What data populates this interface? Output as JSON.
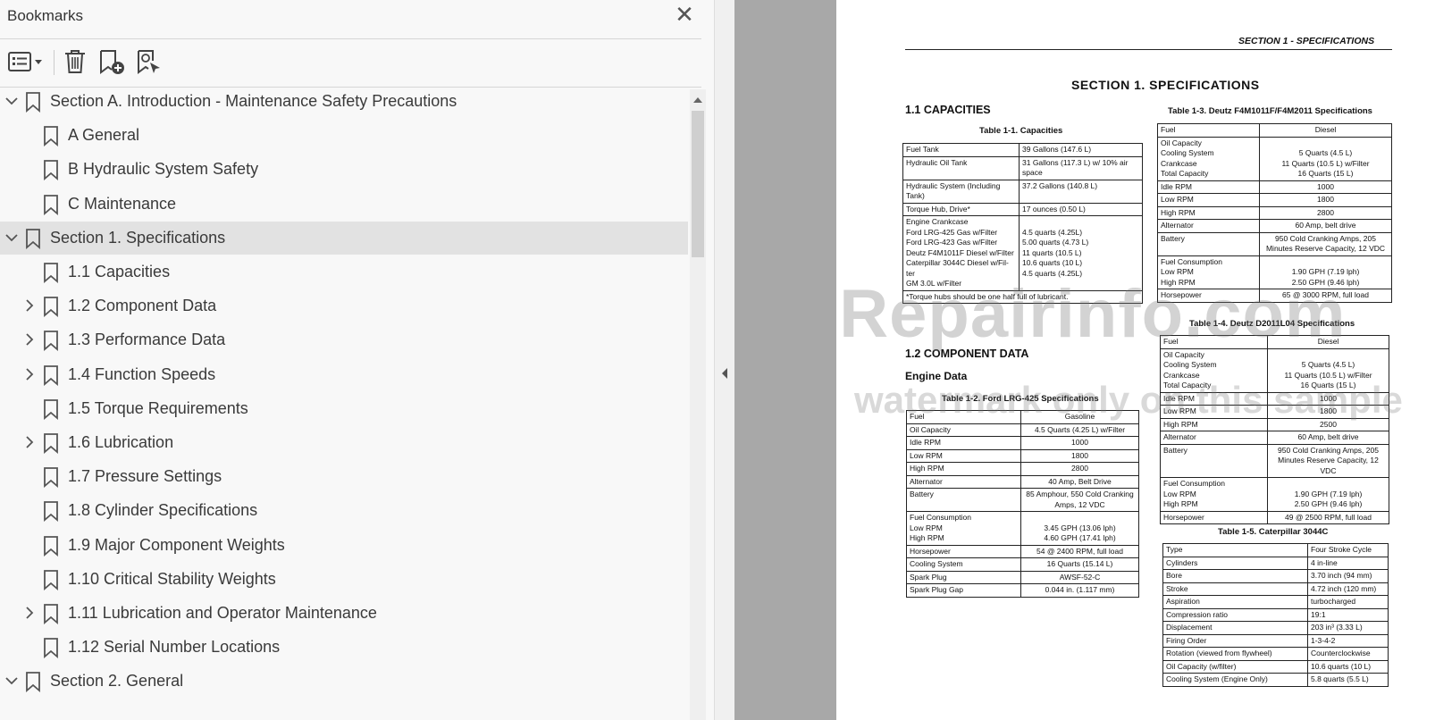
{
  "panel": {
    "title": "Bookmarks",
    "close_glyph": "✕",
    "toolbar": {
      "options_icon": "bookmark-options-icon",
      "delete_icon": "trash-icon",
      "new_bookmark_icon": "new-bookmark-icon",
      "find_bookmark_icon": "find-current-bookmark-icon"
    }
  },
  "bookmarks": [
    {
      "label": "Section A. Introduction - Maintenance Safety Precautions",
      "level": 0,
      "toggle": "expanded"
    },
    {
      "label": "A General",
      "level": 1,
      "toggle": "none"
    },
    {
      "label": "B Hydraulic System Safety",
      "level": 1,
      "toggle": "none"
    },
    {
      "label": "C Maintenance",
      "level": 1,
      "toggle": "none"
    },
    {
      "label": "Section 1. Specifications",
      "level": 0,
      "toggle": "expanded",
      "selected": true
    },
    {
      "label": "1.1 Capacities",
      "level": 1,
      "toggle": "none"
    },
    {
      "label": "1.2 Component Data",
      "level": 1,
      "toggle": "collapsed"
    },
    {
      "label": "1.3 Performance Data",
      "level": 1,
      "toggle": "collapsed"
    },
    {
      "label": "1.4 Function Speeds",
      "level": 1,
      "toggle": "collapsed"
    },
    {
      "label": "1.5 Torque Requirements",
      "level": 1,
      "toggle": "none"
    },
    {
      "label": "1.6 Lubrication",
      "level": 1,
      "toggle": "collapsed"
    },
    {
      "label": "1.7 Pressure Settings",
      "level": 1,
      "toggle": "none"
    },
    {
      "label": "1.8 Cylinder Specifications",
      "level": 1,
      "toggle": "none"
    },
    {
      "label": "1.9 Major Component Weights",
      "level": 1,
      "toggle": "none"
    },
    {
      "label": "1.10 Critical Stability Weights",
      "level": 1,
      "toggle": "none"
    },
    {
      "label": "1.11 Lubrication and Operator Maintenance",
      "level": 1,
      "toggle": "collapsed"
    },
    {
      "label": "1.12 Serial Number Locations",
      "level": 1,
      "toggle": "none"
    },
    {
      "label": "Section 2. General",
      "level": 0,
      "toggle": "expanded"
    }
  ],
  "document": {
    "running_header": "SECTION 1 - SPECIFICATIONS",
    "section_title": "SECTION 1.  SPECIFICATIONS",
    "h_capacities": "1.1   CAPACITIES",
    "h_component": "1.2   COMPONENT DATA",
    "h_engine": "Engine Data",
    "watermark_1": "eRepairinfo.com",
    "watermark_2": "watermark only on this sample",
    "t11": {
      "caption": "Table 1-1. Capacities",
      "rows": [
        [
          "Fuel Tank",
          "39 Gallons (147.6 L)"
        ],
        [
          "Hydraulic Oil Tank",
          "31 Gallons (117.3 L) w/ 10% air space"
        ],
        [
          "Hydraulic System (Including\nTank)",
          "37.2 Gallons (140.8 L)"
        ],
        [
          "Torque Hub, Drive*",
          "17 ounces (0.50 L)"
        ],
        [
          "Engine Crankcase\n   Ford LRG-425 Gas w/Filter\n   Ford LRG-423 Gas w/Filter\n   Deutz F4M1011F Diesel w/Filter\n   Caterpillar 3044C Diesel w/Fil-\nter\n   GM 3.0L w/Filter",
          "\n4.5 quarts (4.25L)\n5.00 quarts (4.73 L)\n11 quarts (10.5 L)\n10.6 quarts (10 L)\n4.5 quarts (4.25L)"
        ],
        [
          "*Torque hubs should be one half full of lubricant.",
          ""
        ]
      ]
    },
    "t12": {
      "caption": "Table 1-2. Ford LRG-425 Specifications",
      "rows": [
        [
          "Fuel",
          "Gasoline"
        ],
        [
          "Oil Capacity",
          "4.5 Quarts (4.25 L) w/Filter"
        ],
        [
          "Idle RPM",
          "1000"
        ],
        [
          "Low RPM",
          "1800"
        ],
        [
          "High RPM",
          "2800"
        ],
        [
          "Alternator",
          "40 Amp, Belt Drive"
        ],
        [
          "Battery",
          "85 Amphour, 550 Cold Cranking\nAmps, 12 VDC"
        ],
        [
          "Fuel Consumption\n   Low RPM\n   High RPM",
          "\n3.45 GPH (13.06 lph)\n4.60 GPH (17.41 lph)"
        ],
        [
          "Horsepower",
          "54 @ 2400 RPM, full load"
        ],
        [
          "Cooling System",
          "16 Quarts (15.14 L)"
        ],
        [
          "Spark Plug",
          "AWSF-52-C"
        ],
        [
          "Spark Plug Gap",
          "0.044 in. (1.117 mm)"
        ]
      ]
    },
    "t13": {
      "caption": "Table 1-3. Deutz F4M1011F/F4M2011 Specifications",
      "rows": [
        [
          "Fuel",
          "Diesel"
        ],
        [
          "Oil Capacity\n   Cooling System\n   Crankcase\n   Total Capacity",
          "\n5 Quarts (4.5 L)\n11 Quarts (10.5 L) w/Filter\n16 Quarts (15 L)"
        ],
        [
          "Idle RPM",
          "1000"
        ],
        [
          "Low RPM",
          "1800"
        ],
        [
          "High RPM",
          "2800"
        ],
        [
          "Alternator",
          "60 Amp, belt drive"
        ],
        [
          "Battery",
          "950 Cold Cranking Amps, 205\nMinutes Reserve Capacity, 12 VDC"
        ],
        [
          "Fuel Consumption\n   Low RPM\n   High RPM",
          "\n1.90 GPH (7.19 lph)\n2.50 GPH (9.46 lph)"
        ],
        [
          "Horsepower",
          "65 @ 3000 RPM, full load"
        ]
      ]
    },
    "t14": {
      "caption": "Table 1-4. Deutz D2011L04 Specifications",
      "rows": [
        [
          "Fuel",
          "Diesel"
        ],
        [
          "Oil Capacity\n   Cooling System\n   Crankcase\n   Total Capacity",
          "\n5 Quarts (4.5 L)\n11 Quarts (10.5 L) w/Filter\n16 Quarts (15 L)"
        ],
        [
          "Idle RPM",
          "1000"
        ],
        [
          "Low RPM",
          "1800"
        ],
        [
          "High RPM",
          "2500"
        ],
        [
          "Alternator",
          "60 Amp, belt drive"
        ],
        [
          "Battery",
          "950 Cold Cranking Amps, 205\nMinutes Reserve Capacity, 12 VDC"
        ],
        [
          "Fuel Consumption\n   Low RPM\n   High RPM",
          "\n1.90 GPH (7.19 lph)\n2.50 GPH (9.46 lph)"
        ],
        [
          "Horsepower",
          "49 @ 2500 RPM, full load"
        ]
      ]
    },
    "t15": {
      "caption": "Table 1-5. Caterpillar 3044C",
      "rows": [
        [
          "Type",
          "Four Stroke Cycle"
        ],
        [
          "Cylinders",
          "4 in-line"
        ],
        [
          "Bore",
          "3.70 inch (94 mm)"
        ],
        [
          "Stroke",
          "4.72 inch (120 mm)"
        ],
        [
          "Aspiration",
          "turbocharged"
        ],
        [
          "Compression ratio",
          "19:1"
        ],
        [
          "Displacement",
          "203 in³ (3.33 L)"
        ],
        [
          "Firing Order",
          "1-3-4-2"
        ],
        [
          "Rotation (viewed from flywheel)",
          "Counterclockwise"
        ],
        [
          "Oil Capacity (w/filter)",
          "10.6 quarts (10 L)"
        ],
        [
          "Cooling System (Engine Only)",
          "5.8 quarts (5.5 L)"
        ]
      ]
    }
  }
}
